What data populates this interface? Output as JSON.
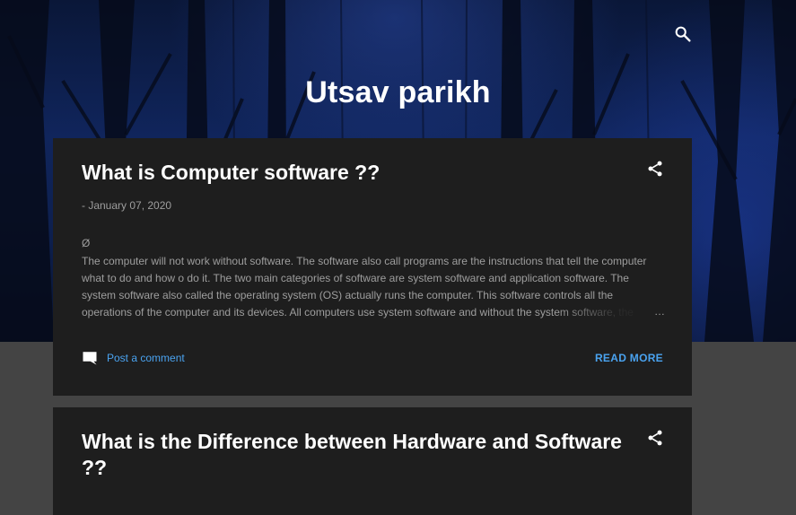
{
  "header": {
    "site_title": "Utsav parikh",
    "search_icon": "search-icon"
  },
  "posts": [
    {
      "title": "What is Computer software ??",
      "date": "- January 07, 2020",
      "snippet_symbol": "Ø",
      "snippet": "The computer will not work without software. The software also call programs are the instructions that tell the computer what to do and how o do it. The two main categories of software are system software and application software. The system software also called the operating system (OS) actually runs the computer. This software controls all the operations of the computer and its devices. All computers use system software and without the system software, the",
      "ellipsis": "…",
      "comment_label": "Post a comment",
      "read_more_label": "READ MORE",
      "share_icon": "share-icon",
      "comment_icon": "comment-icon"
    },
    {
      "title": "What is the Difference between Hardware and Software ??",
      "share_icon": "share-icon"
    }
  ],
  "colors": {
    "page_background": "#444444",
    "card_background": "#1e1e1e",
    "link": "#4aa3f0",
    "muted_text": "#9e9e9e",
    "title_text": "#ffffff"
  }
}
